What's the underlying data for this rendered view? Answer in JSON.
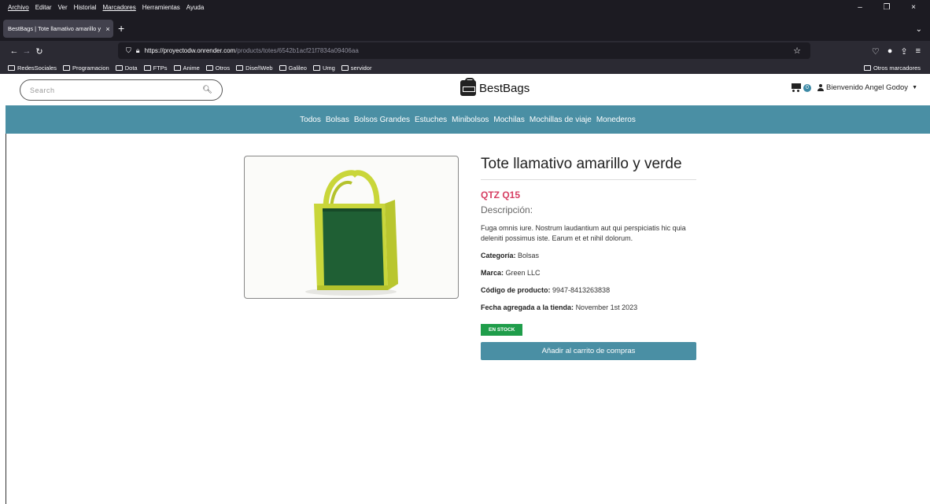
{
  "menubar": {
    "items": [
      "Archivo",
      "Editar",
      "Ver",
      "Historial",
      "Marcadores",
      "Herramientas",
      "Ayuda"
    ]
  },
  "window_controls": {
    "minimize": "–",
    "maximize": "❐",
    "close": "×"
  },
  "tab": {
    "title": "BestBags | Tote llamativo amarillo y",
    "close": "×"
  },
  "newtab_label": "+",
  "url": {
    "host": "https://proyectodw.onrender.com",
    "path": "/products/totes/6542b1acf21f7834a09406aa"
  },
  "bookmarks": {
    "items": [
      "RedesSociales",
      "Programacion",
      "Dota",
      "FTPs",
      "Anime",
      "Otros",
      "DiseñWeb",
      "Galileo",
      "Umg",
      "servidor"
    ],
    "other": "Otros marcadores"
  },
  "header": {
    "search_placeholder": "Search",
    "brand": "BestBags",
    "cart_count": "0",
    "user_greeting": "Bienvenido Angel Godoy"
  },
  "categories": [
    "Todos",
    "Bolsas",
    "Bolsos Grandes",
    "Estuches",
    "Minibolsos",
    "Mochilas",
    "Mochillas de viaje",
    "Monederos"
  ],
  "product": {
    "title": "Tote llamativo amarillo y verde",
    "price": "QTZ Q15",
    "description_heading": "Descripción:",
    "description": "Fuga omnis iure. Nostrum laudantium aut qui perspiciatis hic quia deleniti possimus iste. Earum et et nihil dolorum.",
    "category_label": "Categoría:",
    "category": "Bolsas",
    "brand_label": "Marca:",
    "brand": "Green LLC",
    "code_label": "Código de producto:",
    "code": "9947-8413263838",
    "date_label": "Fecha agregada a la tienda:",
    "date": "November 1st 2023",
    "stock": "EN STOCK",
    "add_to_cart": "Añadir al carrito de compras"
  },
  "colors": {
    "accent": "#4a8fa4",
    "price": "#d63e62",
    "stock": "#1f9d4a",
    "bag_green": "#1f5f34",
    "bag_yellow": "#c9d63a"
  }
}
